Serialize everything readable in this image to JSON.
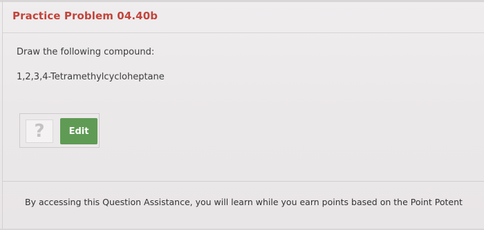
{
  "problem": {
    "title": "Practice Problem 04.40b",
    "instruction": "Draw the following compound:",
    "compound_name": "1,2,3,4-Tetramethylcycloheptane"
  },
  "drawing_widget": {
    "placeholder_icon": "question-mark-icon",
    "placeholder_glyph": "?",
    "edit_label": "Edit",
    "edit_color": "#5f9b55"
  },
  "assistance": {
    "text": "By accessing this Question Assistance, you will learn while you earn points based on the Point Potent"
  },
  "colors": {
    "title": "#c2443b"
  }
}
